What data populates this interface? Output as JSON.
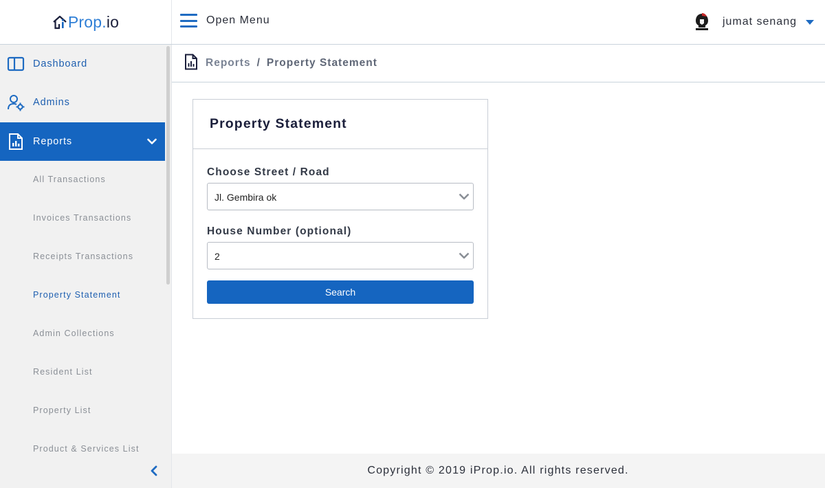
{
  "brand": {
    "logo_i": "i",
    "logo_prop": "Prop",
    "logo_dot": ".",
    "logo_io": "io"
  },
  "topbar": {
    "menu_label": "Open Menu",
    "user_name": "jumat senang"
  },
  "sidebar": {
    "items": [
      {
        "label": "Dashboard",
        "icon": "dashboard-icon"
      },
      {
        "label": "Admins",
        "icon": "admin-user-gear-icon"
      },
      {
        "label": "Reports",
        "icon": "report-document-icon",
        "expanded": true
      }
    ],
    "report_subitems": [
      {
        "label": "All Transactions"
      },
      {
        "label": "Invoices Transactions"
      },
      {
        "label": "Receipts Transactions"
      },
      {
        "label": "Property Statement",
        "current": true
      },
      {
        "label": "Admin Collections"
      },
      {
        "label": "Resident List"
      },
      {
        "label": "Property List"
      },
      {
        "label": "Product & Services List"
      }
    ]
  },
  "breadcrumb": {
    "root": "Reports",
    "separator": "/",
    "current": "Property Statement"
  },
  "card": {
    "title": "Property Statement",
    "street_label": "Choose Street / Road",
    "street_value": "Jl. Gembira ok",
    "house_label": "House Number (optional)",
    "house_value": "2",
    "search_label": "Search"
  },
  "footer": {
    "text": "Copyright © 2019 iProp.io. All rights reserved."
  },
  "colors": {
    "primary": "#1565c0",
    "sidebar_bg": "#f1f1f1",
    "muted_text": "#8a8f96"
  }
}
